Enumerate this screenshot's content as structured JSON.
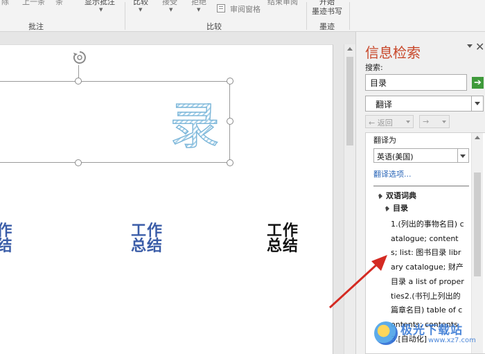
{
  "ribbon": {
    "items_top": {
      "delete": "除",
      "prev": "上一条",
      "next": "下一条",
      "next2": "条",
      "show_comments": "显示批注",
      "compare": "比较",
      "accept": "接受",
      "reject": "拒绝",
      "review_pane": "审阅窗格",
      "end_review": "结束审阅",
      "start": "开始",
      "ink": "墨迹书写"
    },
    "groups": {
      "comments": "批注",
      "compare": "比较",
      "ink": "墨迹"
    }
  },
  "document": {
    "title_char": "录",
    "wordart_items": [
      {
        "text": "作\n结",
        "color": "blue"
      },
      {
        "text": "工作\n总结",
        "color": "blue"
      },
      {
        "text": "工作\n总结",
        "color": "black"
      }
    ]
  },
  "research_pane": {
    "title": "信息检索",
    "close": "✕",
    "search_label": "搜索:",
    "search_value": "目录",
    "go": "➔",
    "service": "翻译",
    "back": "返回",
    "back_arrow": "←",
    "forward_arrow": "→",
    "translate_to_label": "翻译为",
    "target_language": "英语(美国)",
    "translate_options": "翻译选项...",
    "bilingual_dict": "双语词典",
    "headword": "目录",
    "entry": "1.(列出的事物名目) catalogue; contents; list: 图书目录 library catalogue; 财产目录 a list of properties2.(书刊上列出的篇章名目) table of contents; contents3.[自动化]"
  },
  "watermark": {
    "name": "极光下载站",
    "url": "www.xz7.com"
  },
  "colors": {
    "pane_title": "#c8472a",
    "go_button": "#3f9a3b",
    "link": "#2a66b8",
    "wordart_blue": "#3b5da8",
    "arrow": "#d42a22"
  }
}
